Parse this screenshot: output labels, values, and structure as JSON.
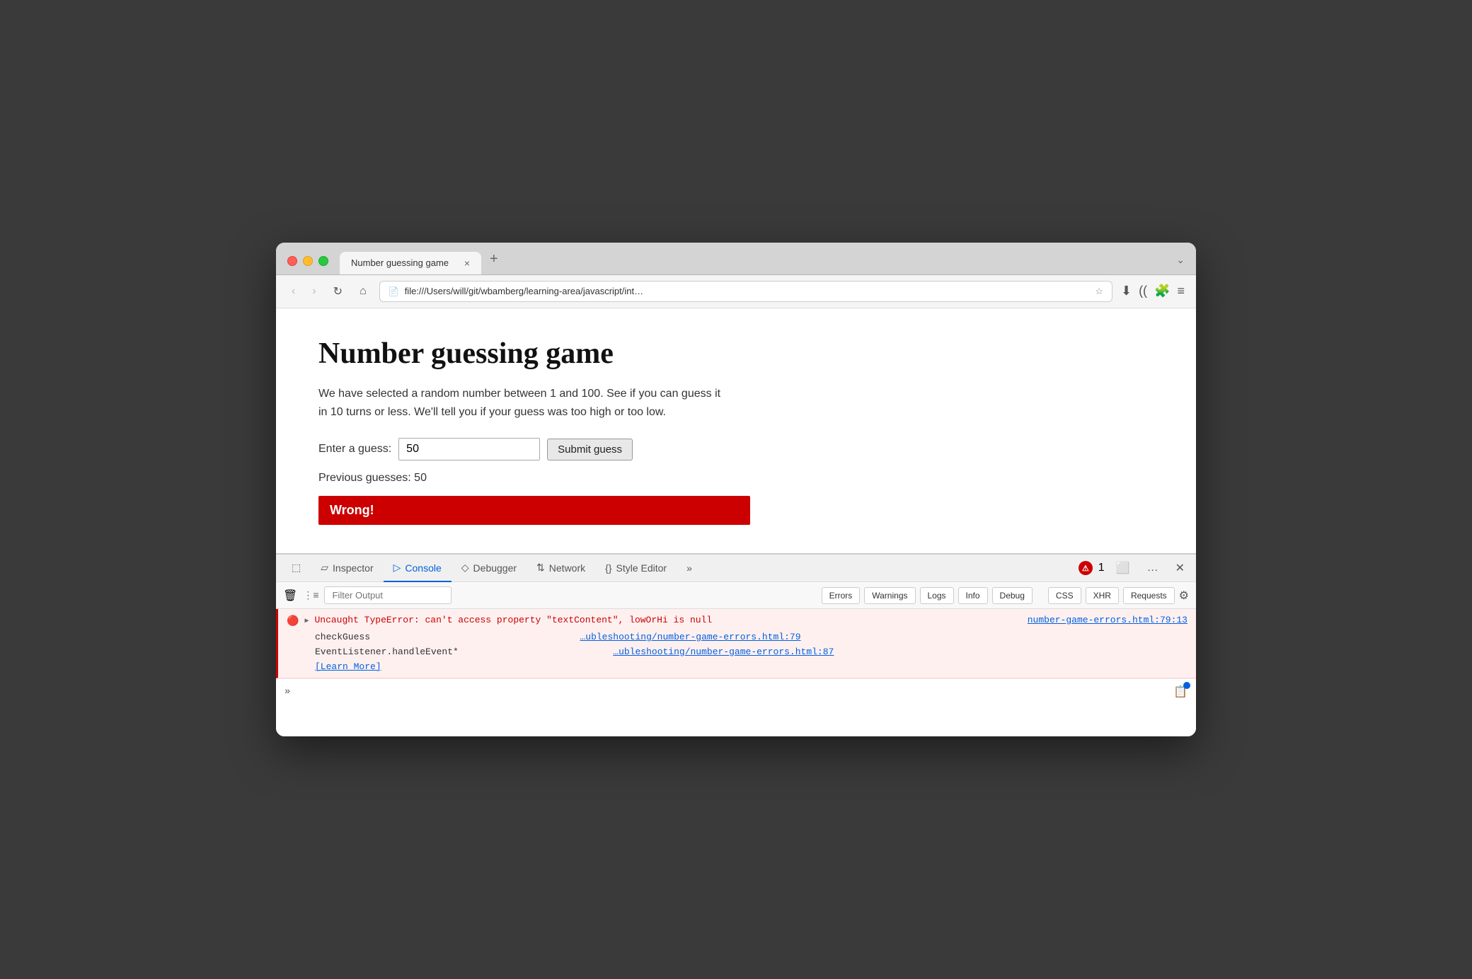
{
  "browser": {
    "tab_title": "Number guessing game",
    "tab_close": "×",
    "new_tab": "+",
    "tab_dropdown": "⌄",
    "address": "file:///Users/will/git/wbamberg/learning-area/javascript/int…",
    "nav_back": "‹",
    "nav_forward": "›",
    "nav_refresh": "↻",
    "nav_home": "⌂",
    "nav_download": "⬇",
    "nav_rss": ")",
    "nav_extensions": "⬡",
    "nav_menu": "≡"
  },
  "page": {
    "title": "Number guessing game",
    "description": "We have selected a random number between 1 and 100. See if you can guess it in 10 turns or less. We'll tell you if your guess was too high or too low.",
    "guess_label": "Enter a guess:",
    "guess_value": "50",
    "submit_label": "Submit guess",
    "previous_label": "Previous guesses: 50",
    "wrong_text": "Wrong!"
  },
  "devtools": {
    "tabs": [
      {
        "id": "selector",
        "label": "",
        "icon": "⬚",
        "active": false
      },
      {
        "id": "inspector",
        "label": "Inspector",
        "icon": "▱",
        "active": false
      },
      {
        "id": "console",
        "label": "Console",
        "icon": "▷",
        "active": true
      },
      {
        "id": "debugger",
        "label": "Debugger",
        "icon": "◇",
        "active": false
      },
      {
        "id": "network",
        "label": "Network",
        "icon": "↕",
        "active": false
      },
      {
        "id": "style-editor",
        "label": "Style Editor",
        "icon": "{}",
        "active": false
      },
      {
        "id": "more",
        "label": "»",
        "icon": "",
        "active": false
      }
    ],
    "error_count": "1",
    "action_responsive": "⬜",
    "action_more": "…",
    "action_close": "×"
  },
  "console": {
    "filter_placeholder": "Filter Output",
    "filter_buttons": [
      "Errors",
      "Warnings",
      "Logs",
      "Info",
      "Debug"
    ],
    "right_buttons": [
      "CSS",
      "XHR",
      "Requests"
    ],
    "error": {
      "main_text": "Uncaught TypeError: can't access property \"textContent\", lowOrHi is null",
      "location": "number-game-errors.html:79:13",
      "stack": [
        {
          "func": "checkGuess",
          "location": "…ubleshooting/number-game-errors.html:79"
        },
        {
          "func": "EventListener.handleEvent*",
          "location": "…ubleshooting/number-game-errors.html:87"
        }
      ],
      "learn_more": "[Learn More]"
    },
    "prompt": "»"
  }
}
